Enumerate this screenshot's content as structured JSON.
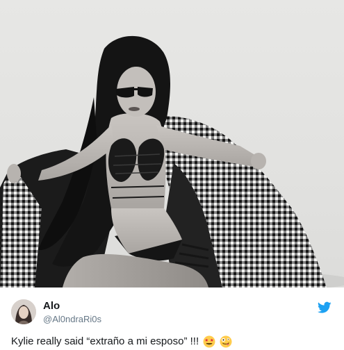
{
  "tweet": {
    "author_name": "Alo",
    "author_handle": "@Al0ndraRi0s",
    "text": "Kylie really said “extraño a mi esposo” !!!",
    "emojis": [
      "star-struck-emoji",
      "zany-face-emoji"
    ],
    "platform_icon": "twitter-bird-icon",
    "brand_color": "#1da1f2"
  },
  "media": {
    "type": "photo",
    "style": "black-and-white"
  }
}
